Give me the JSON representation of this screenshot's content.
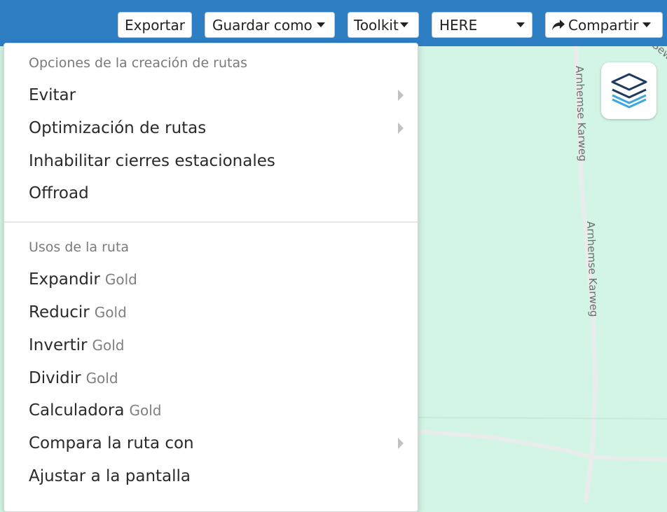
{
  "toolbar": {
    "export_label": "Exportar",
    "save_as_label": "Guardar como",
    "toolkit_label": "Toolkit",
    "provider_value": "HERE",
    "share_label": "Compartir"
  },
  "map": {
    "road_label_1": "Arnhemse Karweg",
    "road_label_2": "Arnhemse Karweg",
    "road_label_3": "Sew"
  },
  "menu": {
    "routing_header": "Opciones de la creación de rutas",
    "routing_items": [
      {
        "label": "Evitar"
      },
      {
        "label": "Optimización de rutas"
      },
      {
        "label": "Inhabilitar cierres estacionales"
      },
      {
        "label": "Offroad"
      }
    ],
    "uses_header": "Usos de la ruta",
    "uses_items": [
      {
        "label": "Expandir",
        "badge": "Gold"
      },
      {
        "label": "Reducir",
        "badge": "Gold"
      },
      {
        "label": "Invertir",
        "badge": "Gold"
      },
      {
        "label": "Dividir",
        "badge": "Gold"
      },
      {
        "label": "Calculadora",
        "badge": "Gold"
      },
      {
        "label": "Compara la ruta con"
      },
      {
        "label": "Ajustar a la pantalla"
      }
    ]
  },
  "colors": {
    "topbar": "#2e7ec4",
    "map_background": "#d2f5e6",
    "road": "#e8ecea",
    "layers_icon_dark": "#1f3a5f",
    "layers_icon_light": "#3ba7e0"
  },
  "icons": {
    "share": "share-arrow-icon",
    "layers": "layers-icon",
    "submenu": "chevron-right-icon",
    "dropdown": "caret-down-icon"
  }
}
